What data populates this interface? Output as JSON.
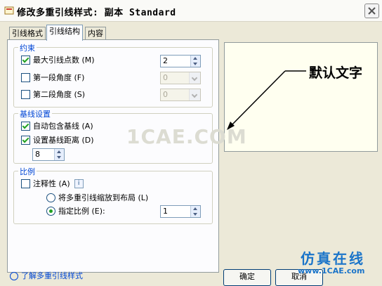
{
  "window": {
    "title": "修改多重引线样式: 副本 Standard",
    "close_label": "×"
  },
  "tabs": [
    {
      "label": "引线格式",
      "active": false
    },
    {
      "label": "引线结构",
      "active": true
    },
    {
      "label": "内容",
      "active": false
    }
  ],
  "constraints": {
    "title": "约束",
    "max_points": {
      "label": "最大引线点数 (M)",
      "checked": true,
      "value": "2"
    },
    "first_angle": {
      "label": "第一段角度 (F)",
      "checked": false,
      "value": "0"
    },
    "second_angle": {
      "label": "第二段角度 (S)",
      "checked": false,
      "value": "0"
    }
  },
  "landing": {
    "title": "基线设置",
    "auto_include": {
      "label": "自动包含基线 (A)",
      "checked": true
    },
    "set_distance": {
      "label": "设置基线距离 (D)",
      "checked": true
    },
    "distance_value": "8"
  },
  "scale": {
    "title": "比例",
    "annotative": {
      "label": "注释性 (A)",
      "checked": false
    },
    "info_icon": "i",
    "scale_to_layout": {
      "label": "将多重引线缩放到布局 (L)",
      "selected": false
    },
    "specify_scale": {
      "label": "指定比例 (E):",
      "selected": true,
      "value": "1"
    }
  },
  "preview": {
    "text": "默认文字"
  },
  "watermark": "1CAE.COM",
  "footer": {
    "link": "了解多重引线样式",
    "ok": "确定",
    "cancel": "取消"
  },
  "branding": {
    "mark": "仿真在线",
    "url": "www.1CAE.com"
  },
  "colors": {
    "accent": "#0046d5",
    "check": "#21a121",
    "brand": "#1a74c9"
  }
}
